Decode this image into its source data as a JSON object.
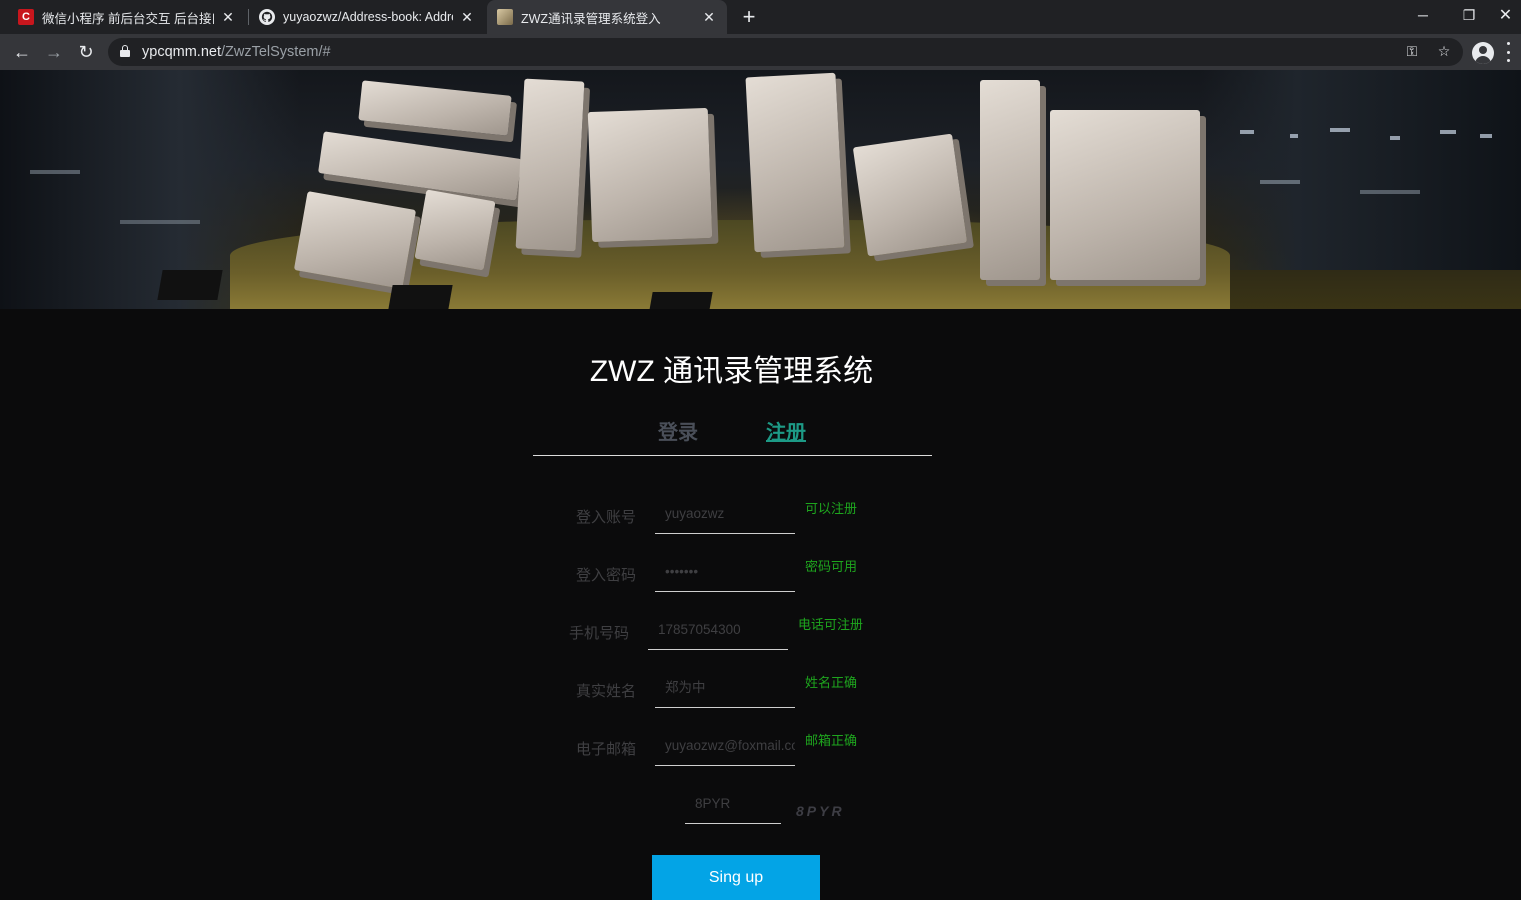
{
  "browser": {
    "tabs": [
      {
        "title": "微信小程序 前后台交互 后台接口",
        "icon": "csdn-icon"
      },
      {
        "title": "yuyaozwz/Address-book: Address",
        "icon": "github-icon"
      },
      {
        "title": "ZWZ通讯录管理系统登入",
        "icon": "site-favicon"
      }
    ],
    "new_tab": "+",
    "url_host": "ypcqmm.net",
    "url_path": "/ZwzTelSystem/#"
  },
  "page": {
    "title": "ZWZ 通讯录管理系统",
    "tab_login": "登录",
    "tab_register": "注册"
  },
  "form": {
    "account": {
      "label": "登入账号",
      "value": "yuyaozwz",
      "status": "可以注册"
    },
    "password": {
      "label": "登入密码",
      "value": "•••••••",
      "status": "密码可用"
    },
    "phone": {
      "label": "手机号码",
      "value": "17857054300",
      "status": "电话可注册"
    },
    "realname": {
      "label": "真实姓名",
      "value": "郑为中",
      "status": "姓名正确"
    },
    "email": {
      "label": "电子邮箱",
      "value": "yuyaozwz@foxmail.com",
      "status": "邮箱正确"
    },
    "captcha": {
      "value": "8PYR",
      "image_text": "8PYR"
    },
    "submit_label": "Sing up"
  },
  "colors": {
    "accent_green": "#1d9a86",
    "status_green": "#1ea51e",
    "button_blue": "#03a4e6",
    "background": "#0b0b0c"
  }
}
